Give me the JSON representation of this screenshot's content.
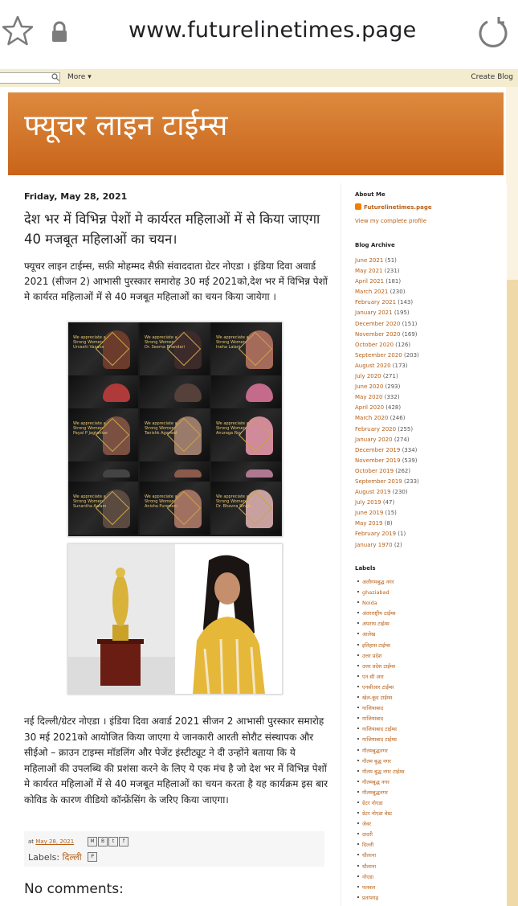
{
  "browser": {
    "url": "www.futurelinetimes.page"
  },
  "navbar": {
    "more_label": "More",
    "create_blog_label": "Create Blog"
  },
  "blog": {
    "title": "फ्यूचर लाइन टाईम्स"
  },
  "post": {
    "date": "Friday, May 28, 2021",
    "title": "देश भर में विभिन्न पेशों मे कार्यरत महिलाओं में से किया जाएगा 40 मजबूत महिलाओं का चयन।",
    "intro": "फ्यूचर लाइन टाईम्स, सफ़ी मोहम्मद सैफ़ी संवाददाता ग्रेटर नोएडा । इंडिया दिवा अवार्ड 2021 (सीजन 2) आभासी पुरस्कार समारोह 30 मई 2021को,देश भर में विभिन्न पेशों मे कार्यरत महिलाओं में से 40 मजबूत महिलाओं का चयन किया जायेगा ।",
    "body": "नई दिल्ली/ग्रेटर नोएडा । इंडिया दिवा अवार्ड 2021 सीजन 2 आभासी पुरस्कार समारोह 30 मई 2021को आयोजित किया जाएगा ये जानकारी आरती सोरौट संस्थापक और सीईओ – क्राउन टाइम्स मॉडलिंग और पेजेंट इंस्टीट्यूट ने दी उन्होंने बताया कि ये महिलाओं की उपलब्धि की प्रशंसा करने के लिए ये एक मंच है जो देश भर में विभिन्न पेशों मे कार्यरत महिलाओं में से 40 मजबूत महिलाओं का चयन करता है यह कार्यक्रम इस बार कोविड के कारण वीडियो कॉन्फ्रेंसिंग के जरिए किया जाएगा।",
    "posted_at_prefix": "at",
    "posted_at": "May 28, 2021",
    "labels_prefix": "Labels:",
    "label": "दिल्ली",
    "share_icons": [
      "M",
      "B",
      "t",
      "f",
      "P"
    ],
    "collage_captions": [
      [
        "We appreciate a",
        "Strong Women",
        "Urvashi Vasava"
      ],
      [
        "We appreciate a",
        "Strong Women",
        "Dr. Seema Bhandari"
      ],
      [
        "We appreciate a",
        "Strong Women",
        "Ineha Lalani"
      ],
      [
        "",
        "",
        ""
      ],
      [
        "",
        "",
        ""
      ],
      [
        "",
        "",
        ""
      ],
      [
        "We appreciate a",
        "Strong Women",
        "Payal P Jagtankar"
      ],
      [
        "We appreciate a",
        "Strong Women",
        "Tanishk Agarwal"
      ],
      [
        "We appreciate a",
        "Strong Women",
        "Anuraga Roy"
      ],
      [
        "",
        "",
        ""
      ],
      [
        "",
        "",
        ""
      ],
      [
        "",
        "",
        ""
      ],
      [
        "We appreciate a",
        "Strong Women",
        "Sunantha Aalam"
      ],
      [
        "We appreciate a",
        "Strong Women",
        "Anisha Purswani"
      ],
      [
        "We appreciate a",
        "Strong Women",
        "Dr. Bhavna Singh"
      ]
    ]
  },
  "comments": {
    "heading": "No comments:"
  },
  "sidebar": {
    "about_heading": "About Me",
    "profile_name": "Futurelinetimes.page",
    "view_profile": "View my complete profile",
    "archive_heading": "Blog Archive",
    "archive": [
      {
        "month": "June 2021",
        "count": "(51)"
      },
      {
        "month": "May 2021",
        "count": "(231)"
      },
      {
        "month": "April 2021",
        "count": "(181)"
      },
      {
        "month": "March 2021",
        "count": "(230)"
      },
      {
        "month": "February 2021",
        "count": "(143)"
      },
      {
        "month": "January 2021",
        "count": "(195)"
      },
      {
        "month": "December 2020",
        "count": "(151)"
      },
      {
        "month": "November 2020",
        "count": "(169)"
      },
      {
        "month": "October 2020",
        "count": "(126)"
      },
      {
        "month": "September 2020",
        "count": "(203)"
      },
      {
        "month": "August 2020",
        "count": "(173)"
      },
      {
        "month": "July 2020",
        "count": "(271)"
      },
      {
        "month": "June 2020",
        "count": "(293)"
      },
      {
        "month": "May 2020",
        "count": "(332)"
      },
      {
        "month": "April 2020",
        "count": "(428)"
      },
      {
        "month": "March 2020",
        "count": "(246)"
      },
      {
        "month": "February 2020",
        "count": "(255)"
      },
      {
        "month": "January 2020",
        "count": "(274)"
      },
      {
        "month": "December 2019",
        "count": "(334)"
      },
      {
        "month": "November 2019",
        "count": "(539)"
      },
      {
        "month": "October 2019",
        "count": "(262)"
      },
      {
        "month": "September 2019",
        "count": "(233)"
      },
      {
        "month": "August 2019",
        "count": "(230)"
      },
      {
        "month": "July 2019",
        "count": "(47)"
      },
      {
        "month": "June 2019",
        "count": "(15)"
      },
      {
        "month": "May 2019",
        "count": "(8)"
      },
      {
        "month": "February 2019",
        "count": "(1)"
      },
      {
        "month": "January 1970",
        "count": "(2)"
      }
    ],
    "labels_heading": "Labels",
    "labels": [
      "अलीगमबुद्ध नगर",
      "ghaziabad",
      "Noida",
      "अंतरराष्ट्रीय टाईम्स",
      "अपराध टाईम्स",
      "आलेख",
      "इतिहास टाईम्स",
      "उत्तर प्रदेश",
      "उत्तर प्रदेश टाईम्स",
      "एन सी आर",
      "एनसीआर टाईम्स",
      "खेल-कूद टाईम्स",
      "गाजियाबाद",
      "गाजियाबाद",
      "गाजियाबाद टाईम्स",
      "गाजियाबाद टाईम्स",
      "गौतमबुद्धनगर",
      "गौतम बुद्ध नगर",
      "गौतम बुद्ध नगर टाईम्स",
      "गौतमबुद्ध नगर",
      "गौतमबुद्धनगर",
      "ग्रेटर नोएडा",
      "ग्रेटर नोएडा वेस्ट",
      "जेवर",
      "दादरी",
      "दिल्ली",
      "धौलाना",
      "धौलाना",
      "नोएडा",
      "पलवल",
      "प्रतापगढ़"
    ]
  }
}
